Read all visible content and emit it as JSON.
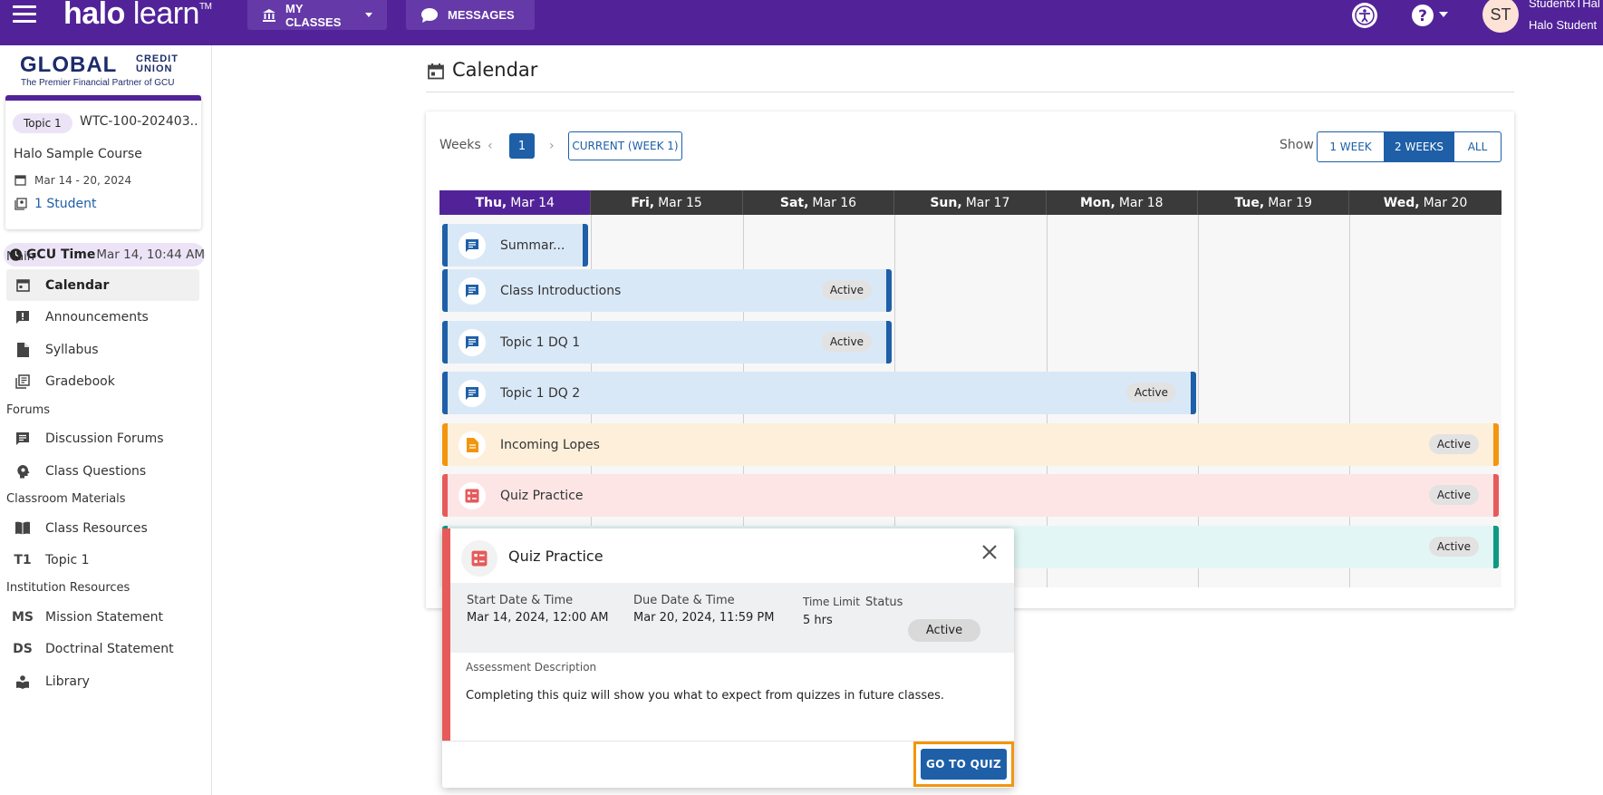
{
  "topbar": {
    "logo_halo": "halo",
    "logo_learn": "learn",
    "logo_tm": "TM",
    "my_classes": "MY CLASSES",
    "messages": "MESSAGES",
    "avatar_initials": "ST",
    "user_name": "StudentxTHal",
    "user_role": "Halo Student",
    "colors": {
      "brand": "#522398"
    }
  },
  "sidebar": {
    "logo_main": "GLOBAL",
    "logo_credit": "CREDIT",
    "logo_union": "UNION",
    "logo_tagline": "The Premier Financial Partner of GCU",
    "course": {
      "topic": "Topic 1",
      "code": "WTC-100-202403...",
      "name": "Halo Sample Course",
      "dates": "Mar 14 - 20, 2024",
      "students": "1 Student"
    },
    "time_label": "GCU Time",
    "time_value": "Mar 14, 10:44 AM",
    "sections": {
      "main": "Main",
      "forums": "Forums",
      "classroom": "Classroom Materials",
      "institution": "Institution Resources"
    },
    "items": {
      "calendar": "Calendar",
      "announcements": "Announcements",
      "syllabus": "Syllabus",
      "gradebook": "Gradebook",
      "discussion": "Discussion Forums",
      "questions": "Class Questions",
      "resources": "Class Resources",
      "topic1": "Topic 1",
      "topic1_abbr": "T1",
      "mission": "Mission Statement",
      "mission_abbr": "MS",
      "doctrinal": "Doctrinal Statement",
      "doctrinal_abbr": "DS",
      "library": "Library"
    }
  },
  "main": {
    "title": "Calendar",
    "weeks_label": "Weeks",
    "prev": "‹",
    "next": "›",
    "week_num": "1",
    "current_week": "CURRENT (WEEK 1)",
    "show_label": "Show",
    "show_options": [
      "1 WEEK",
      "2 WEEKS",
      "ALL"
    ],
    "days": [
      {
        "dow": "Thu,",
        "date": "Mar 14"
      },
      {
        "dow": "Fri,",
        "date": "Mar 15"
      },
      {
        "dow": "Sat,",
        "date": "Mar 16"
      },
      {
        "dow": "Sun,",
        "date": "Mar 17"
      },
      {
        "dow": "Mon,",
        "date": "Mar 18"
      },
      {
        "dow": "Tue,",
        "date": "Mar 19"
      },
      {
        "dow": "Wed,",
        "date": "Mar 20"
      }
    ],
    "events": {
      "summary": "Summar...",
      "intro": "Class Introductions",
      "dq1": "Topic 1 DQ 1",
      "dq2": "Topic 1 DQ 2",
      "lopes": "Incoming Lopes",
      "quiz": "Quiz Practice",
      "badge": "Active"
    }
  },
  "popup": {
    "title": "Quiz Practice",
    "start_label": "Start Date & Time",
    "start_value": "Mar 14, 2024, 12:00 AM",
    "due_label": "Due Date & Time",
    "due_value": "Mar 20, 2024, 11:59 PM",
    "limit_label": "Time Limit",
    "limit_value": "5 hrs",
    "status_label": "Status",
    "status_value": "Active",
    "desc_label": "Assessment Description",
    "desc": "Completing this quiz will show you what to expect from quizzes in future classes.",
    "go_quiz": "GO TO QUIZ"
  }
}
